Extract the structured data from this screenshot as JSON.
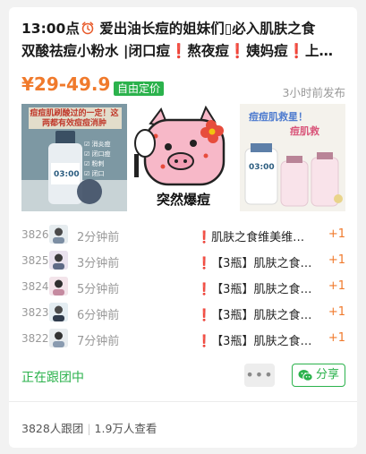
{
  "post": {
    "title_time": "13:00点",
    "title_rest": " 爱出油长痘的姐妹们▯必入肌肤之食",
    "title_line2": "双酸祛痘小粉水 |闭口痘❗熬夜痘❗姨妈痘❗上火…",
    "price": "¥29-49.9",
    "price_badge": "自由定价",
    "posted_ago": "3小时前发布"
  },
  "images": {
    "img1_text_top": "痘痘肌刷酸过的一定！这两都有效痘痘消肿",
    "img1_label": "03:00",
    "img1_checks": [
      "消炎痘",
      "闭口痘",
      "粉刺",
      "闭口"
    ],
    "img2_caption": "突然爆痘",
    "img3_text_top": "痘痘肌救星！",
    "img3_text_mid": "痘肌救",
    "img3_label": "03:00"
  },
  "followers": [
    {
      "num": "3826",
      "ago": "2分钟前",
      "item": "❗肌肤之食维美维…",
      "plus": "+1"
    },
    {
      "num": "3825",
      "ago": "3分钟前",
      "item": "❗【3瓶】肌肤之食…",
      "plus": "+1"
    },
    {
      "num": "3824",
      "ago": "5分钟前",
      "item": "❗【3瓶】肌肤之食…",
      "plus": "+1"
    },
    {
      "num": "3823",
      "ago": "6分钟前",
      "item": "❗【3瓶】肌肤之食…",
      "plus": "+1"
    },
    {
      "num": "3822",
      "ago": "7分钟前",
      "item": "❗【3瓶】肌肤之食…",
      "plus": "+1"
    }
  ],
  "actions": {
    "status": "正在跟团中",
    "more": "•••",
    "share": "分享"
  },
  "stats": {
    "joined": "3828人跟团",
    "views": "1.9万人查看"
  },
  "colors": {
    "accent_green": "#2bb24c",
    "price_orange": "#f07a2c"
  },
  "icons": [
    "alarm-clock-icon",
    "wechat-icon",
    "more-icon"
  ]
}
